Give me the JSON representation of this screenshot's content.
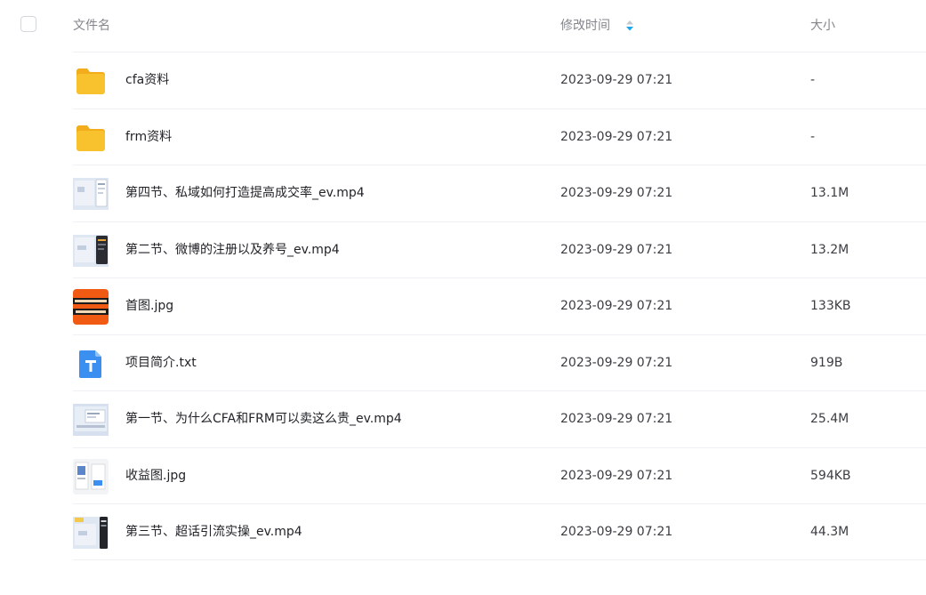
{
  "header": {
    "name_label": "文件名",
    "time_label": "修改时间",
    "size_label": "大小"
  },
  "colors": {
    "folder": "#f7c22e",
    "txt_icon": "#3a8ff0",
    "image_orange": "#f15a12",
    "sort_active": "#1aa7ee"
  },
  "files": [
    {
      "name": "cfa资料",
      "time": "2023-09-29 07:21",
      "size": "-",
      "icon": "folder-icon"
    },
    {
      "name": "frm资料",
      "time": "2023-09-29 07:21",
      "size": "-",
      "icon": "folder-icon"
    },
    {
      "name": "第四节、私域如何打造提高成交率_ev.mp4",
      "time": "2023-09-29 07:21",
      "size": "13.1M",
      "icon": "video-thumbnail-icon"
    },
    {
      "name": "第二节、微博的注册以及养号_ev.mp4",
      "time": "2023-09-29 07:21",
      "size": "13.2M",
      "icon": "video-thumbnail-icon"
    },
    {
      "name": "首图.jpg",
      "time": "2023-09-29 07:21",
      "size": "133KB",
      "icon": "image-thumbnail-icon"
    },
    {
      "name": "项目简介.txt",
      "time": "2023-09-29 07:21",
      "size": "919B",
      "icon": "txt-file-icon"
    },
    {
      "name": "第一节、为什么CFA和FRM可以卖这么贵_ev.mp4",
      "time": "2023-09-29 07:21",
      "size": "25.4M",
      "icon": "video-thumbnail-icon"
    },
    {
      "name": "收益图.jpg",
      "time": "2023-09-29 07:21",
      "size": "594KB",
      "icon": "image-thumbnail-icon"
    },
    {
      "name": "第三节、超话引流实操_ev.mp4",
      "time": "2023-09-29 07:21",
      "size": "44.3M",
      "icon": "video-thumbnail-icon"
    }
  ]
}
